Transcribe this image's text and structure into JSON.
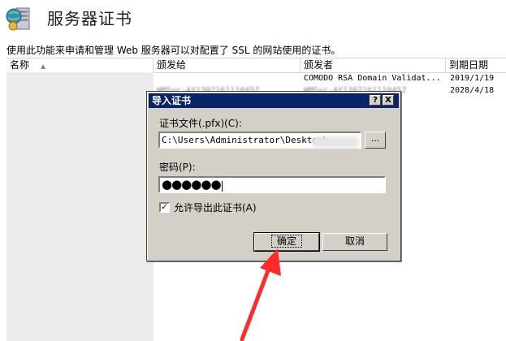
{
  "header": {
    "title": "服务器证书",
    "icon": "certificate-server-icon"
  },
  "description": "使用此功能来申请和管理 Web 服务器可以对配置了 SSL 的网站使用的证书。",
  "list": {
    "columns": [
      "名称",
      "颁发给",
      "颁发者",
      "到期日期"
    ],
    "rows": [
      {
        "name": "",
        "issued_to": "",
        "issuer": "COMODO RSA Domain Validat...",
        "expiry": "2019/1/19"
      },
      {
        "name": "",
        "issued_to": "WMSvc-AY130716111045Z",
        "issuer": "WMSvc-AY130716111045Z",
        "expiry": "2028/4/18"
      }
    ]
  },
  "dialog": {
    "title": "导入证书",
    "help_button": "?",
    "close_button": "X",
    "file_label": "证书文件(.pfx)(C):",
    "file_value": "C:\\Users\\Administrator\\Desktop\\",
    "browse_label": "...",
    "password_label": "密码(P):",
    "password_value": "●●●●●●",
    "allow_export_label": "允许导出此证书(A)",
    "allow_export_checked": true,
    "ok_label": "确定",
    "cancel_label": "取消"
  },
  "colors": {
    "titlebar": "#0a246a",
    "dialog_bg": "#d4d0c8",
    "annotation_arrow": "#ff2a2a"
  }
}
